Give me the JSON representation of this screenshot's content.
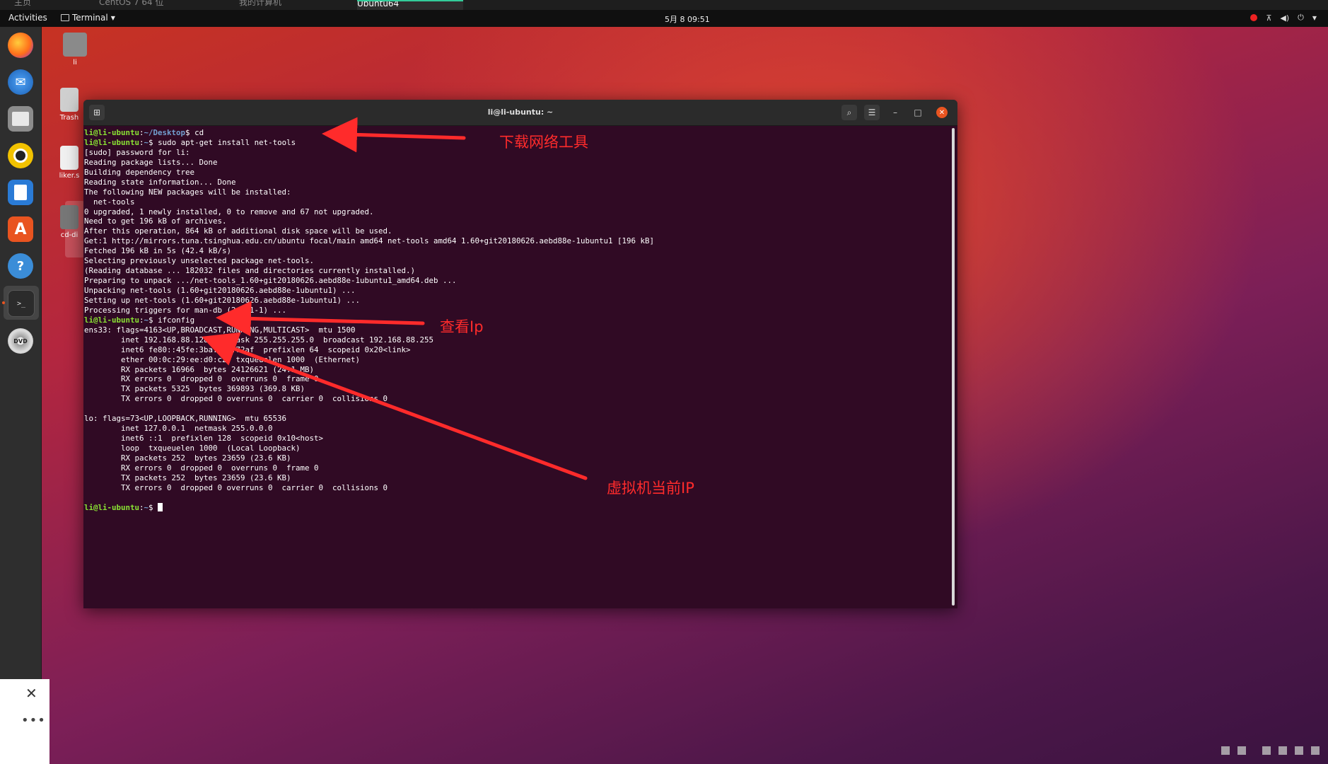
{
  "host_tabs": [
    {
      "label": "主页"
    },
    {
      "label": "CentOS 7 64 位"
    },
    {
      "label": "我的计算机"
    },
    {
      "label": "Ubuntu64"
    }
  ],
  "topbar": {
    "activities": "Activities",
    "app_menu": "Terminal",
    "clock": "5月 8  09:51"
  },
  "desktop_icons": [
    {
      "label": "li"
    },
    {
      "label": "Trash"
    },
    {
      "label": "liker.s"
    },
    {
      "label": "cd-di"
    }
  ],
  "terminal": {
    "title": "li@li-ubuntu: ~",
    "lines": [
      {
        "user": "li@li-ubuntu",
        "path": "~/Desktop",
        "cmd": " cd"
      },
      {
        "user": "li@li-ubuntu",
        "path": "~",
        "cmd": " sudo apt-get install net-tools"
      },
      {
        "text": "[sudo] password for li:"
      },
      {
        "text": "Reading package lists... Done"
      },
      {
        "text": "Building dependency tree"
      },
      {
        "text": "Reading state information... Done"
      },
      {
        "text": "The following NEW packages will be installed:"
      },
      {
        "text": "  net-tools"
      },
      {
        "text": "0 upgraded, 1 newly installed, 0 to remove and 67 not upgraded."
      },
      {
        "text": "Need to get 196 kB of archives."
      },
      {
        "text": "After this operation, 864 kB of additional disk space will be used."
      },
      {
        "text": "Get:1 http://mirrors.tuna.tsinghua.edu.cn/ubuntu focal/main amd64 net-tools amd64 1.60+git20180626.aebd88e-1ubuntu1 [196 kB]"
      },
      {
        "text": "Fetched 196 kB in 5s (42.4 kB/s)"
      },
      {
        "text": "Selecting previously unselected package net-tools."
      },
      {
        "text": "(Reading database ... 182032 files and directories currently installed.)"
      },
      {
        "text": "Preparing to unpack .../net-tools_1.60+git20180626.aebd88e-1ubuntu1_amd64.deb ..."
      },
      {
        "text": "Unpacking net-tools (1.60+git20180626.aebd88e-1ubuntu1) ..."
      },
      {
        "text": "Setting up net-tools (1.60+git20180626.aebd88e-1ubuntu1) ..."
      },
      {
        "text": "Processing triggers for man-db (2.9.1-1) ..."
      },
      {
        "user": "li@li-ubuntu",
        "path": "~",
        "cmd": " ifconfig"
      },
      {
        "text": "ens33: flags=4163<UP,BROADCAST,RUNNING,MULTICAST>  mtu 1500"
      },
      {
        "text": "        inet 192.168.88.128  netmask 255.255.255.0  broadcast 192.168.88.255"
      },
      {
        "text": "        inet6 fe80::45fe:3ba:d19:72af  prefixlen 64  scopeid 0x20<link>"
      },
      {
        "text": "        ether 00:0c:29:ee:d0:c2  txqueuelen 1000  (Ethernet)"
      },
      {
        "text": "        RX packets 16966  bytes 24126621 (24.1 MB)"
      },
      {
        "text": "        RX errors 0  dropped 0  overruns 0  frame 0"
      },
      {
        "text": "        TX packets 5325  bytes 369893 (369.8 KB)"
      },
      {
        "text": "        TX errors 0  dropped 0 overruns 0  carrier 0  collisions 0"
      },
      {
        "text": ""
      },
      {
        "text": "lo: flags=73<UP,LOOPBACK,RUNNING>  mtu 65536"
      },
      {
        "text": "        inet 127.0.0.1  netmask 255.0.0.0"
      },
      {
        "text": "        inet6 ::1  prefixlen 128  scopeid 0x10<host>"
      },
      {
        "text": "        loop  txqueuelen 1000  (Local Loopback)"
      },
      {
        "text": "        RX packets 252  bytes 23659 (23.6 KB)"
      },
      {
        "text": "        RX errors 0  dropped 0  overruns 0  frame 0"
      },
      {
        "text": "        TX packets 252  bytes 23659 (23.6 KB)"
      },
      {
        "text": "        TX errors 0  dropped 0 overruns 0  carrier 0  collisions 0"
      },
      {
        "text": ""
      },
      {
        "user": "li@li-ubuntu",
        "path": "~",
        "cmd": " ",
        "cursor": true
      }
    ]
  },
  "annotations": {
    "download": "下载网络工具",
    "check_ip": "查看Ip",
    "current_ip": "虚拟机当前IP"
  },
  "colors": {
    "terminal_bg": "#300a24",
    "prompt_user": "#8ae234",
    "prompt_path": "#729fcf",
    "annotation": "#ff2b2b",
    "close_button": "#e95420"
  },
  "icons": [
    "firefox-icon",
    "thunderbird-icon",
    "files-icon",
    "rhythmbox-icon",
    "writer-icon",
    "software-icon",
    "help-icon",
    "terminal-icon",
    "dvd-icon"
  ]
}
